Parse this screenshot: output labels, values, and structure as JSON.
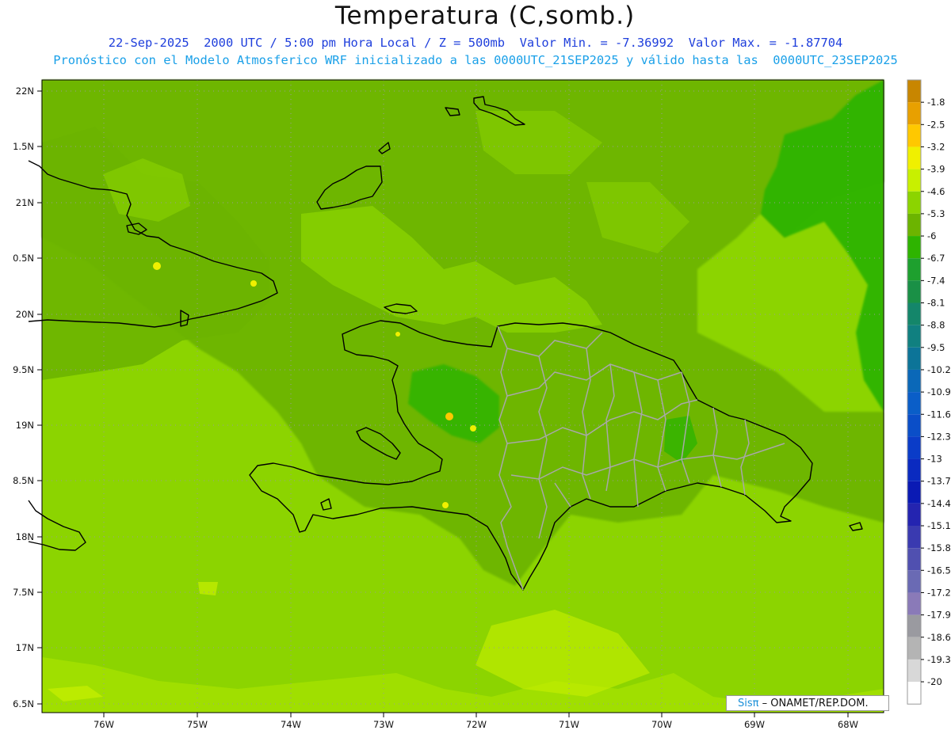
{
  "header": {
    "title": "Temperatura (C,somb.)",
    "line1": "22-Sep-2025  2000 UTC / 5:00 pm Hora Local / Z = 500mb  Valor Min. = -7.36992  Valor Max. = -1.87704",
    "line2": "Pronóstico con el Modelo Atmosferico WRF inicializado a las 0000UTC_21SEP2025 y válido hasta las  0000UTC_23SEP2025"
  },
  "axes": {
    "lat_labels": [
      "22N",
      "1.5N",
      "21N",
      "0.5N",
      "20N",
      "9.5N",
      "19N",
      "8.5N",
      "18N",
      "7.5N",
      "17N",
      "6.5N"
    ],
    "lon_labels": [
      "76W",
      "75W",
      "74W",
      "73W",
      "72W",
      "71W",
      "70W",
      "69W",
      "68W"
    ]
  },
  "colorbar": {
    "labels": [
      "-1.8",
      "-2.5",
      "-3.2",
      "-3.9",
      "-4.6",
      "-5.3",
      "-6",
      "-6.7",
      "-7.4",
      "-8.1",
      "-8.8",
      "-9.5",
      "-10.2",
      "-10.9",
      "-11.6",
      "-12.3",
      "-13",
      "-13.7",
      "-14.4",
      "-15.1",
      "-15.8",
      "-16.5",
      "-17.2",
      "-17.9",
      "-18.6",
      "-19.3",
      "-20"
    ],
    "colors": [
      "#c88600",
      "#e8a000",
      "#ffc800",
      "#f0f000",
      "#c8f000",
      "#8cd400",
      "#6cb400",
      "#2eb400",
      "#1ea02e",
      "#1a9046",
      "#14866a",
      "#108080",
      "#0c7498",
      "#0a68b8",
      "#0a5ec8",
      "#0a4ec8",
      "#0a3cc8",
      "#0a2ac0",
      "#0a1ab4",
      "#2424b0",
      "#3a3ab0",
      "#5050b0",
      "#6a6ab4",
      "#8a7ab8",
      "#9a9aa0",
      "#b4b4b4",
      "#d8d8d8",
      "#ffffff"
    ]
  },
  "credit": {
    "sis": "Sisπ",
    "rest": " – ONAMET/REP.DOM."
  }
}
